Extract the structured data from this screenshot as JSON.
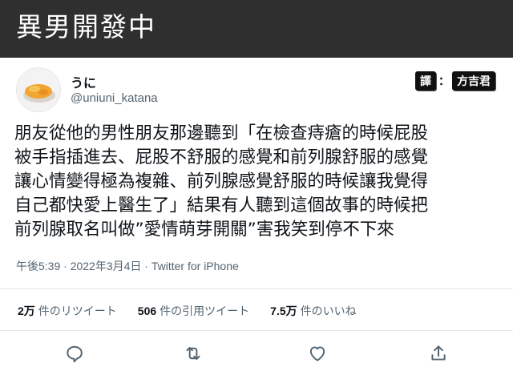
{
  "banner": {
    "title": "異男開發中"
  },
  "user": {
    "display_name": "うに",
    "handle": "@uniuni_katana"
  },
  "translator": {
    "prefix": "譯",
    "separator": "：",
    "name": "方吉君"
  },
  "tweet": {
    "lines": [
      "朋友從他的男性朋友那邊聽到「在檢查痔瘡的時候屁股",
      "被手指插進去、屁股不舒服的感覺和前列腺舒服的感覺",
      "讓心情變得極為複雜、前列腺感覺舒服的時候讓我覺得",
      "自己都快愛上醫生了」結果有人聽到這個故事的時候把",
      "前列腺取名叫做”愛情萌芽開關”害我笑到停不下來"
    ],
    "meta": "午後5:39 · 2022年3月4日 · Twitter for iPhone"
  },
  "stats": [
    {
      "count": "2万",
      "label": "件のリツイート"
    },
    {
      "count": "506",
      "label": "件の引用ツイート"
    },
    {
      "count": "7.5万",
      "label": "件のいいね"
    }
  ],
  "actions": [
    "reply-icon",
    "retweet-icon",
    "like-icon",
    "share-icon"
  ]
}
